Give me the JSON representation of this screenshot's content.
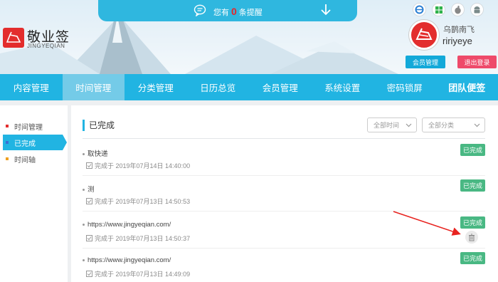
{
  "notice": {
    "prefix": "您有",
    "count": "0",
    "suffix": "条提醒"
  },
  "brand": {
    "name": "敬业签",
    "sub": "JINGYEQIAN"
  },
  "user": {
    "name1": "乌鹊南飞",
    "name2": "ririyeye",
    "member_btn": "会员管理",
    "logout_btn": "退出登录"
  },
  "nav": [
    "内容管理",
    "时间管理",
    "分类管理",
    "日历总览",
    "会员管理",
    "系统设置",
    "密码锁屏",
    "团队便签"
  ],
  "sidebar": [
    {
      "label": "时间管理",
      "color": "#e32d2d"
    },
    {
      "label": "已完成",
      "color": "#3b6fd4"
    },
    {
      "label": "时间轴",
      "color": "#f0a020"
    }
  ],
  "main": {
    "title": "已完成",
    "filter_time": "全部时间",
    "filter_category": "全部分类",
    "badge": "已完成",
    "items": [
      {
        "title": "取快递",
        "meta": "完成于 2019年07月14日 14:40:00"
      },
      {
        "title": "测",
        "meta": "完成于 2019年07月13日 14:50:53"
      },
      {
        "title": "https://www.jingyeqian.com/",
        "meta": "完成于 2019年07月13日 14:50:37"
      },
      {
        "title": "https://www.jingyeqian.com/",
        "meta": "完成于 2019年07月13日 14:49:09"
      }
    ]
  }
}
